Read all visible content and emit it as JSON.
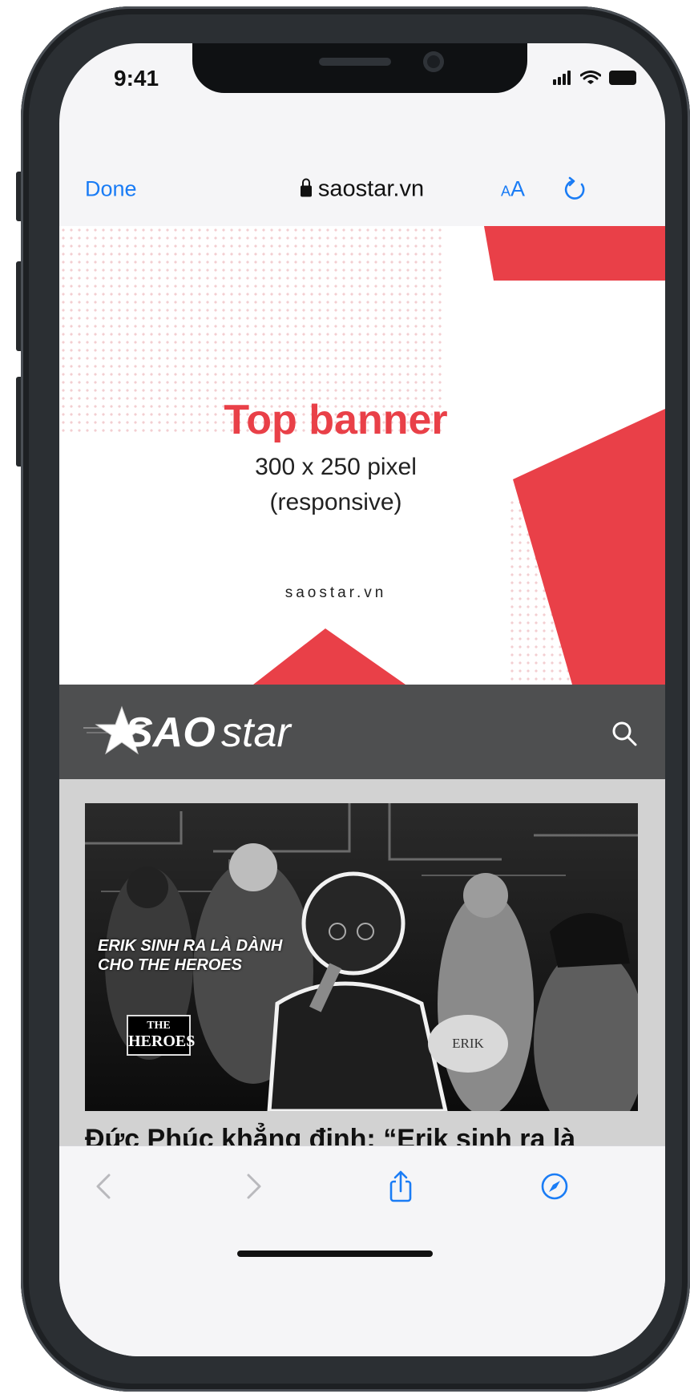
{
  "status_bar": {
    "time": "9:41"
  },
  "browser": {
    "done_label": "Done",
    "domain": "saostar.vn",
    "text_size_small": "A",
    "text_size_large": "A",
    "accent": "#1a7cf5"
  },
  "banner": {
    "title": "Top banner",
    "size_line": "300 x 250 pixel",
    "note": "(responsive)",
    "site": "saostar.vn",
    "accent": "#e94048"
  },
  "site_header": {
    "logo_bold": "SAO",
    "logo_light": "star"
  },
  "article": {
    "overlay_quote": "ERIK SINH RA LÀ DÀNH CHO THE HEROES",
    "show_logo_top": "THE",
    "show_logo_bottom": "HEROES",
    "sign_title": "ERIK",
    "headline": "Đức Phúc khẳng định: “Erik sinh ra là"
  },
  "toolbar": {
    "icons": [
      "back-icon",
      "forward-icon",
      "share-icon",
      "compass-icon"
    ]
  }
}
